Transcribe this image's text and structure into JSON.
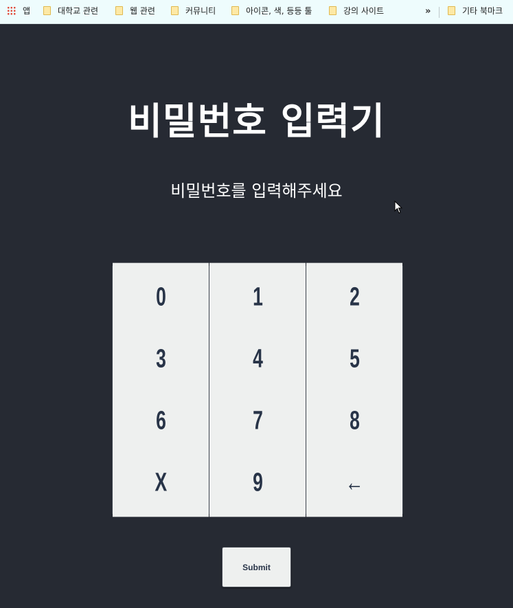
{
  "bookmarks": {
    "apps_label": "앱",
    "items": [
      "대학교 관련",
      "웹 관련",
      "커뮤니티",
      "아이콘, 색, 등등 툴",
      "강의 사이트"
    ],
    "more": "»",
    "other": "기타 북마크"
  },
  "page": {
    "title": "비밀번호 입력기",
    "subtitle": "비밀번호를 입력해주세요"
  },
  "keypad": {
    "keys": [
      "0",
      "1",
      "2",
      "3",
      "4",
      "5",
      "6",
      "7",
      "8",
      "X",
      "9",
      "←"
    ]
  },
  "submit_label": "Submit",
  "colors": {
    "background": "#262a33",
    "key_background": "#eef0ef",
    "key_text": "#283448"
  }
}
